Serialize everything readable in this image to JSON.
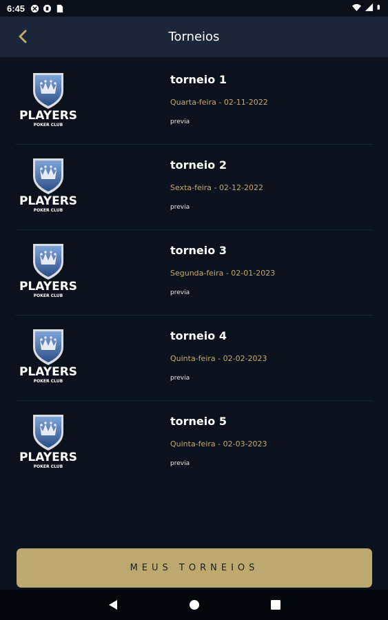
{
  "status_bar": {
    "time": "6:45",
    "left_icons": [
      "notification-icon",
      "notification-icon",
      "sim-card-icon"
    ],
    "right_icons": [
      "wifi-icon",
      "signal-icon",
      "battery-icon"
    ]
  },
  "app_bar": {
    "title": "Torneios",
    "back_icon": "chevron-left-icon"
  },
  "colors": {
    "background": "#0c121d",
    "app_bar": "#1b2738",
    "accent": "#c4ab6b",
    "button": "#bba96f"
  },
  "tournaments": [
    {
      "name": "torneio 1",
      "date": "Quarta-feira - 02-11-2022",
      "link": "previa",
      "logo": "players-poker-club-logo"
    },
    {
      "name": "torneio 2",
      "date": "Sexta-feira - 02-12-2022",
      "link": "previa",
      "logo": "players-poker-club-logo"
    },
    {
      "name": "torneio 3",
      "date": "Segunda-feira - 02-01-2023",
      "link": "previa",
      "logo": "players-poker-club-logo"
    },
    {
      "name": "torneio 4",
      "date": "Quinta-feira - 02-02-2023",
      "link": "previa",
      "logo": "players-poker-club-logo"
    },
    {
      "name": "torneio 5",
      "date": "Quinta-feira - 02-03-2023",
      "link": "previa",
      "logo": "players-poker-club-logo"
    }
  ],
  "logo_text": {
    "brand": "PLAYERS",
    "sub": "POKER CLUB"
  },
  "cta": {
    "label": "MEUS TORNEIOS"
  },
  "nav_bar": {
    "icons": [
      "back-triangle-icon",
      "home-circle-icon",
      "recents-square-icon"
    ]
  }
}
